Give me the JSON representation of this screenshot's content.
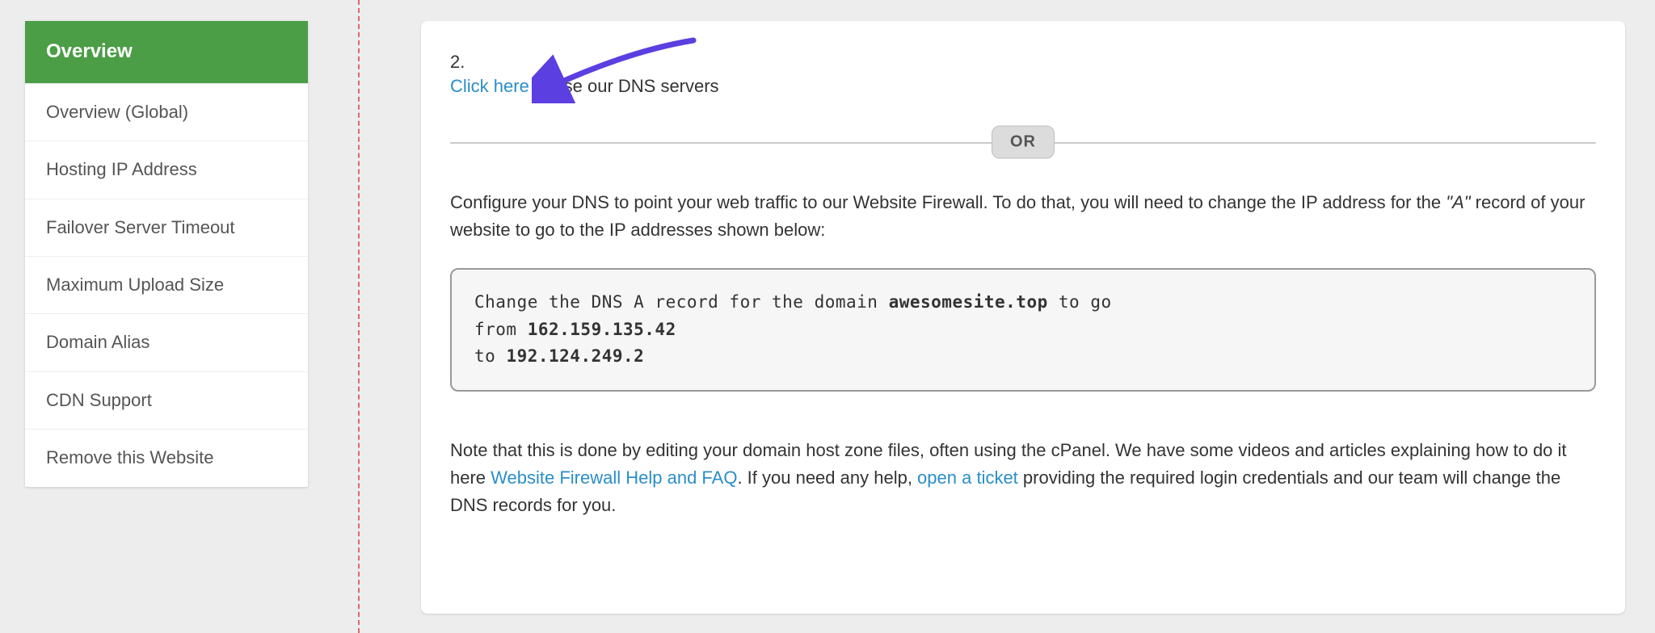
{
  "sidebar": {
    "items": [
      {
        "label": "Overview",
        "active": true
      },
      {
        "label": "Overview (Global)"
      },
      {
        "label": "Hosting IP Address"
      },
      {
        "label": "Failover Server Timeout"
      },
      {
        "label": "Maximum Upload Size"
      },
      {
        "label": "Domain Alias"
      },
      {
        "label": "CDN Support"
      },
      {
        "label": "Remove this Website"
      }
    ]
  },
  "main": {
    "step_number": "2.",
    "click_here": "Click here",
    "click_here_tail": " to use our DNS servers",
    "or_label": "OR",
    "desc_pre": "Configure your DNS to point your web traffic to our Website Firewall. To do that, you will need to change the IP address for the ",
    "desc_ital": "\"A\"",
    "desc_post": " record of your website to go to the IP addresses shown below:",
    "code_l1_pre": "Change the DNS A record for the domain ",
    "code_l1_b": "awesomesite.top",
    "code_l1_post": " to go",
    "code_l2_pre": "from ",
    "code_l2_b": "162.159.135.42",
    "code_l3_pre": "to ",
    "code_l3_b": "192.124.249.2",
    "note_1": "Note that this is done by editing your domain host zone files, often using the cPanel. We have some videos and articles explaining how to do it here ",
    "link_help": "Website Firewall Help and FAQ",
    "note_2": ". If you need any help, ",
    "link_ticket": "open a ticket",
    "note_3": " providing the required login credentials and our team will change the DNS records for you."
  }
}
